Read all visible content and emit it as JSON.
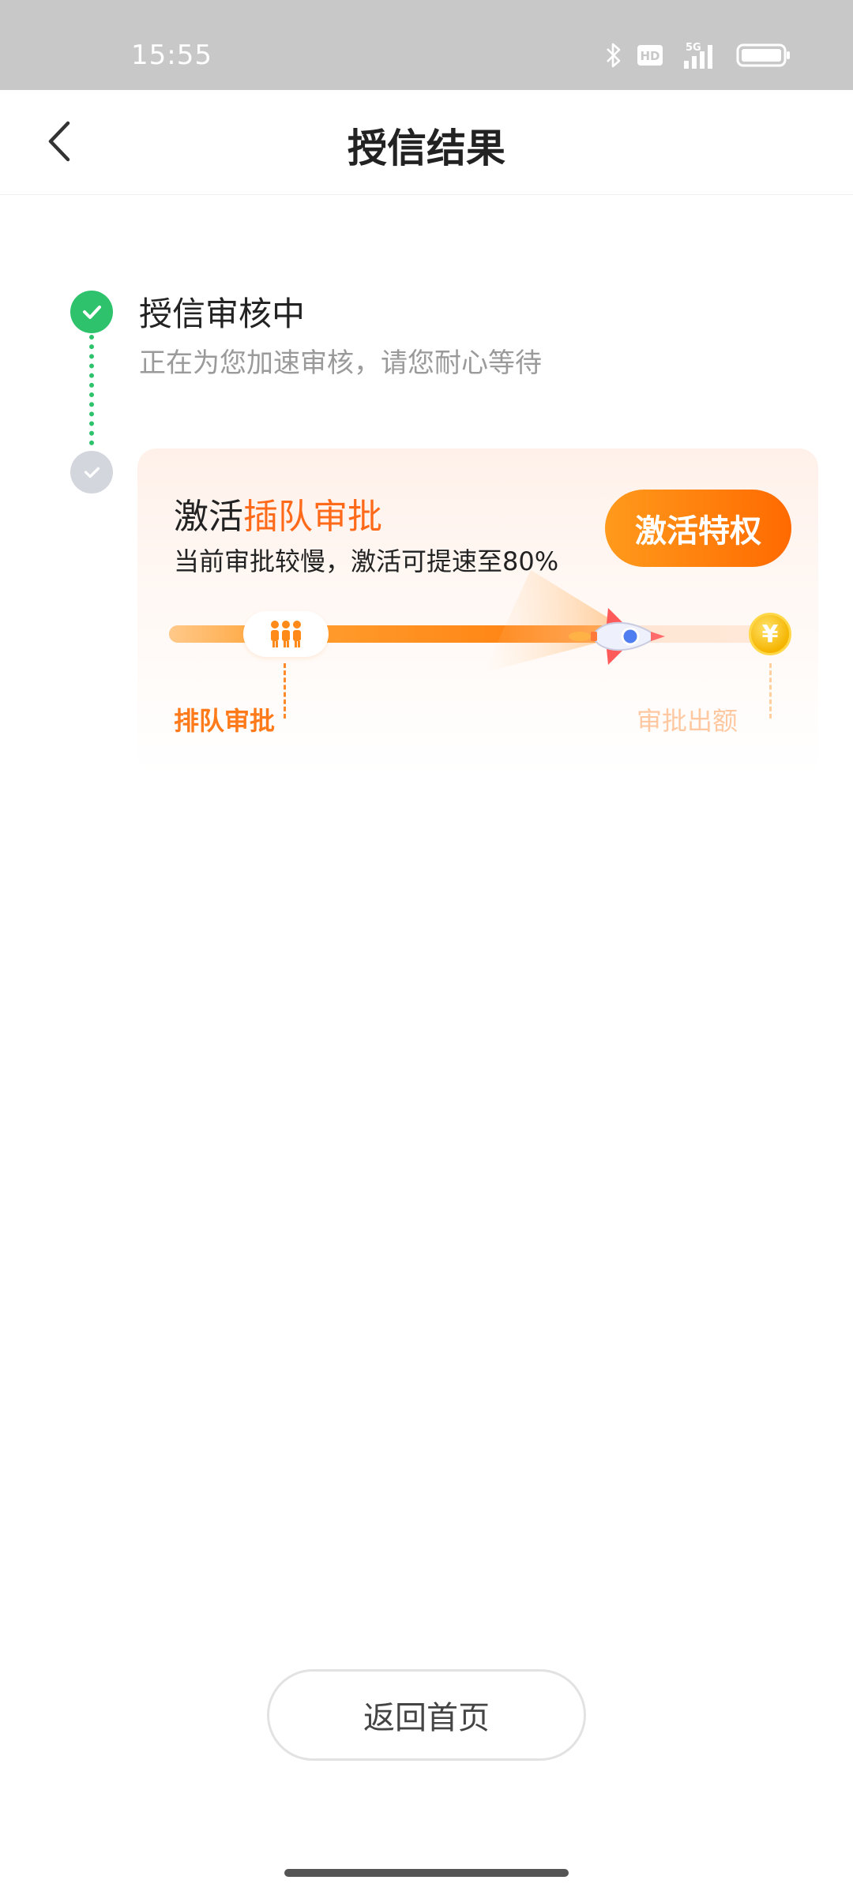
{
  "status_bar": {
    "time": "15:55",
    "icons": [
      "bluetooth-icon",
      "hd-icon",
      "5g-signal-icon",
      "battery-icon"
    ],
    "hd_label": "HD",
    "network_label": "5G"
  },
  "nav": {
    "title": "授信结果",
    "back_icon": "chevron-left-icon"
  },
  "timeline": {
    "step1": {
      "title": "授信审核中",
      "subtitle": "正在为您加速审核，请您耐心等待",
      "status": "done",
      "color": "#2dc26b"
    },
    "step2": {
      "status": "pending",
      "color": "#d3d7dd"
    }
  },
  "card": {
    "title_prefix": "激活",
    "title_highlight": "插队审批",
    "subtitle": "当前审批较慢，激活可提速至80%",
    "button_label": "激活特权",
    "accent": "#ff6a1a",
    "progress": {
      "fill_fraction": 0.5,
      "start_label": "排队审批",
      "end_label": "审批出额",
      "end_icon": "yen-coin-icon",
      "coin_symbol": "¥",
      "queue_icon": "people-icon",
      "rocket_icon": "rocket-icon"
    }
  },
  "footer": {
    "home_button_label": "返回首页"
  }
}
